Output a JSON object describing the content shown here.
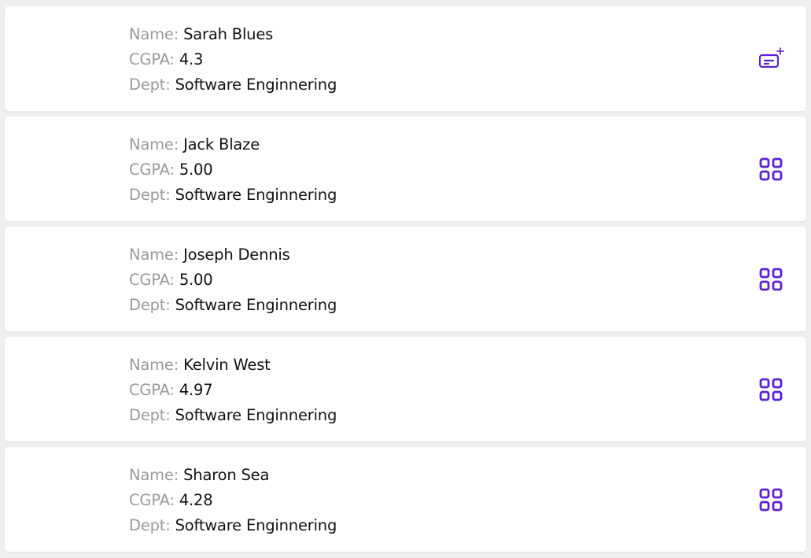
{
  "labels": {
    "name": "Name:",
    "cgpa": "CGPA:",
    "dept": "Dept:"
  },
  "accent_color": "#5b21d6",
  "students": [
    {
      "name": "Sarah Blues",
      "cgpa": "4.3",
      "dept": "Software Enginnering",
      "action_icon": "card-plus-icon"
    },
    {
      "name": "Jack Blaze",
      "cgpa": "5.00",
      "dept": "Software Enginnering",
      "action_icon": "grid-icon"
    },
    {
      "name": "Joseph Dennis",
      "cgpa": "5.00",
      "dept": "Software Enginnering",
      "action_icon": "grid-icon"
    },
    {
      "name": "Kelvin West",
      "cgpa": "4.97",
      "dept": "Software Enginnering",
      "action_icon": "grid-icon"
    },
    {
      "name": "Sharon Sea",
      "cgpa": "4.28",
      "dept": "Software Enginnering",
      "action_icon": "grid-icon"
    }
  ]
}
